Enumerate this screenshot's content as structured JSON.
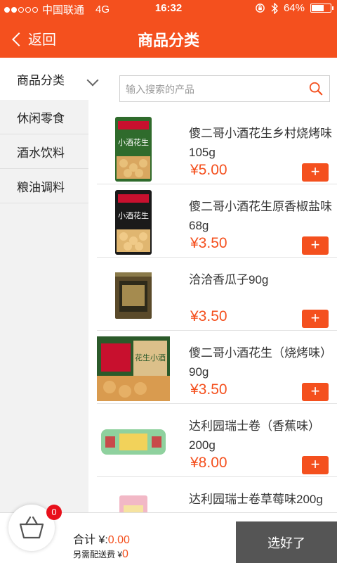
{
  "status_bar": {
    "carrier": "中国联通",
    "network": "4G",
    "time": "16:32",
    "battery": "64%",
    "battery_level": 0.64
  },
  "nav": {
    "back_label": "返回",
    "title": "商品分类"
  },
  "sidebar": {
    "header": "商品分类",
    "items": [
      {
        "label": "休闲零食"
      },
      {
        "label": "酒水饮料"
      },
      {
        "label": "粮油调料"
      }
    ]
  },
  "search": {
    "placeholder": "输入搜索的产品",
    "value": ""
  },
  "products": [
    {
      "name": "傻二哥小酒花生乡村烧烤味105g",
      "price": "¥5.00",
      "thumb_label": "小酒花生",
      "add_label": "+"
    },
    {
      "name": "傻二哥小酒花生原香椒盐味68g",
      "price": "¥3.50",
      "thumb_label": "小酒花生",
      "add_label": "+"
    },
    {
      "name": "洽洽香瓜子90g",
      "price": "¥3.50",
      "thumb_label": "",
      "add_label": "+"
    },
    {
      "name": "傻二哥小酒花生（烧烤味）90g",
      "price": "¥3.50",
      "thumb_label": "花生小酒",
      "add_label": "+"
    },
    {
      "name": "达利园瑞士卷（香蕉味）200g",
      "price": "¥8.00",
      "thumb_label": "",
      "add_label": "+"
    },
    {
      "name": "达利园瑞士卷草莓味200g",
      "price": "",
      "thumb_label": "",
      "add_label": "+"
    }
  ],
  "footer": {
    "cart_count": "0",
    "total_label": "合计 ¥:",
    "total_value": "0.00",
    "delivery_label": "另需配送费 ¥",
    "delivery_value": "0",
    "confirm_label": "选好了"
  },
  "colors": {
    "accent": "#f4501e",
    "confirm_bg": "#555555",
    "badge": "#e8101b"
  }
}
